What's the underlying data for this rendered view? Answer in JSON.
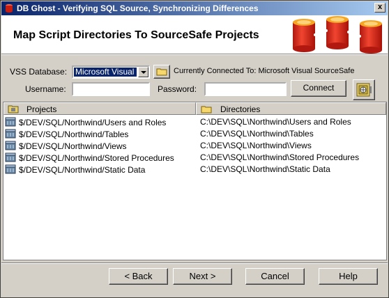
{
  "window": {
    "title": "DB Ghost - Verifying SQL Source, Synchronizing Differences",
    "close_glyph": "x"
  },
  "header": {
    "heading": "Map Script Directories To SourceSafe Projects"
  },
  "form": {
    "vss_database_label": "VSS Database:",
    "vss_database_value": "Microsoft Visual",
    "connected_text": "Currently Connected To: Microsoft Visual SourceSafe",
    "username_label": "Username:",
    "username_value": "",
    "password_label": "Password:",
    "password_value": "",
    "connect_label": "Connect"
  },
  "table": {
    "headers": {
      "projects": "Projects",
      "directories": "Directories"
    },
    "rows": [
      {
        "project": "$/DEV/SQL/Northwind/Users and Roles",
        "directory": "C:\\DEV\\SQL\\Northwind\\Users and Roles"
      },
      {
        "project": "$/DEV/SQL/Northwind/Tables",
        "directory": "C:\\DEV\\SQL\\Northwind\\Tables"
      },
      {
        "project": "$/DEV/SQL/Northwind/Views",
        "directory": "C:\\DEV\\SQL\\Northwind\\Views"
      },
      {
        "project": "$/DEV/SQL/Northwind/Stored Procedures",
        "directory": "C:\\DEV\\SQL\\Northwind\\Stored Procedures"
      },
      {
        "project": "$/DEV/SQL/Northwind/Static Data",
        "directory": "C:\\DEV\\SQL\\Northwind\\Static Data"
      }
    ]
  },
  "footer": {
    "back_label": "< Back",
    "next_label": "Next >",
    "cancel_label": "Cancel",
    "help_label": "Help"
  },
  "icons": {
    "app": "db-ghost-icon",
    "logo": "database-cylinders-logo",
    "browse": "folder-icon",
    "vss": "sourcesafe-vault-icon",
    "project_row": "database-icon",
    "projects_header": "project-folder-icon",
    "directories_header": "folder-icon"
  },
  "colors": {
    "title_start": "#0a246a",
    "title_end": "#a6caf0",
    "selection": "#0a246a",
    "dialog_bg": "#d4d0c8",
    "logo_red": "#e8261c",
    "logo_orange": "#f5a623"
  }
}
